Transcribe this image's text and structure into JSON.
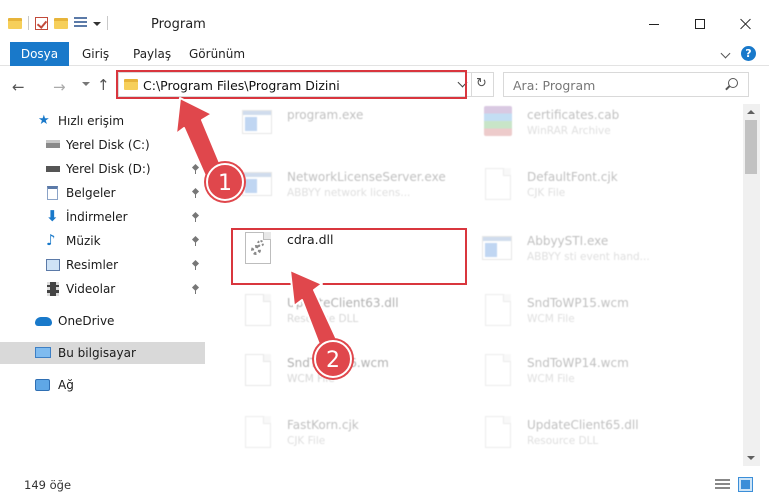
{
  "window": {
    "title": "Program"
  },
  "ribbon": {
    "tabs": [
      "Dosya",
      "Giriş",
      "Paylaş",
      "Görünüm"
    ]
  },
  "address": {
    "path": "C:\\Program Files\\Program Dizini"
  },
  "search": {
    "placeholder": "Ara: Program"
  },
  "sidebar": {
    "items": [
      {
        "label": "Hızlı erişim",
        "icon": "star-icon"
      },
      {
        "label": "Yerel Disk (C:)",
        "icon": "drive-icon"
      },
      {
        "label": "Yerel Disk (D:)",
        "icon": "drive-icon"
      },
      {
        "label": "Belgeler",
        "icon": "documents-icon"
      },
      {
        "label": "İndirmeler",
        "icon": "download-icon"
      },
      {
        "label": "Müzik",
        "icon": "music-icon"
      },
      {
        "label": "Resimler",
        "icon": "pictures-icon"
      },
      {
        "label": "Videolar",
        "icon": "videos-icon"
      },
      {
        "label": "OneDrive",
        "icon": "cloud-icon"
      },
      {
        "label": "Bu bilgisayar",
        "icon": "computer-icon"
      },
      {
        "label": "Ağ",
        "icon": "network-icon"
      }
    ]
  },
  "files": [
    {
      "name": "program.exe",
      "type": "",
      "icon": "exe-icon"
    },
    {
      "name": "certificates.cab",
      "type": "WinRAR Archive",
      "icon": "winrar-icon"
    },
    {
      "name": "NetworkLicenseServer.exe",
      "type": "ABBYY network licens...",
      "icon": "exe-icon"
    },
    {
      "name": "DefaultFont.cjk",
      "type": "CJK File",
      "icon": "document-icon"
    },
    {
      "name": "cdra.dll",
      "type": "",
      "icon": "dll-icon"
    },
    {
      "name": "AbbyySTI.exe",
      "type": "ABBYY sti event hand...",
      "icon": "exe-icon"
    },
    {
      "name": "UpdateClient63.dll",
      "type": "Resource DLL",
      "icon": "dll-icon"
    },
    {
      "name": "SndToWP15.wcm",
      "type": "WCM File",
      "icon": "document-icon"
    },
    {
      "name": "SndToWP16.wcm",
      "type": "WCM File",
      "icon": "document-icon"
    },
    {
      "name": "SndToWP14.wcm",
      "type": "WCM File",
      "icon": "document-icon"
    },
    {
      "name": "FastKorn.cjk",
      "type": "CJK File",
      "icon": "document-icon"
    },
    {
      "name": "UpdateClient65.dll",
      "type": "Resource DLL",
      "icon": "dll-icon"
    }
  ],
  "status": {
    "count": "149 öğe"
  },
  "callouts": [
    "1",
    "2"
  ],
  "colors": {
    "accent": "#1979ca",
    "annotation": "#e0474c",
    "selected": "#d9d9d9"
  }
}
